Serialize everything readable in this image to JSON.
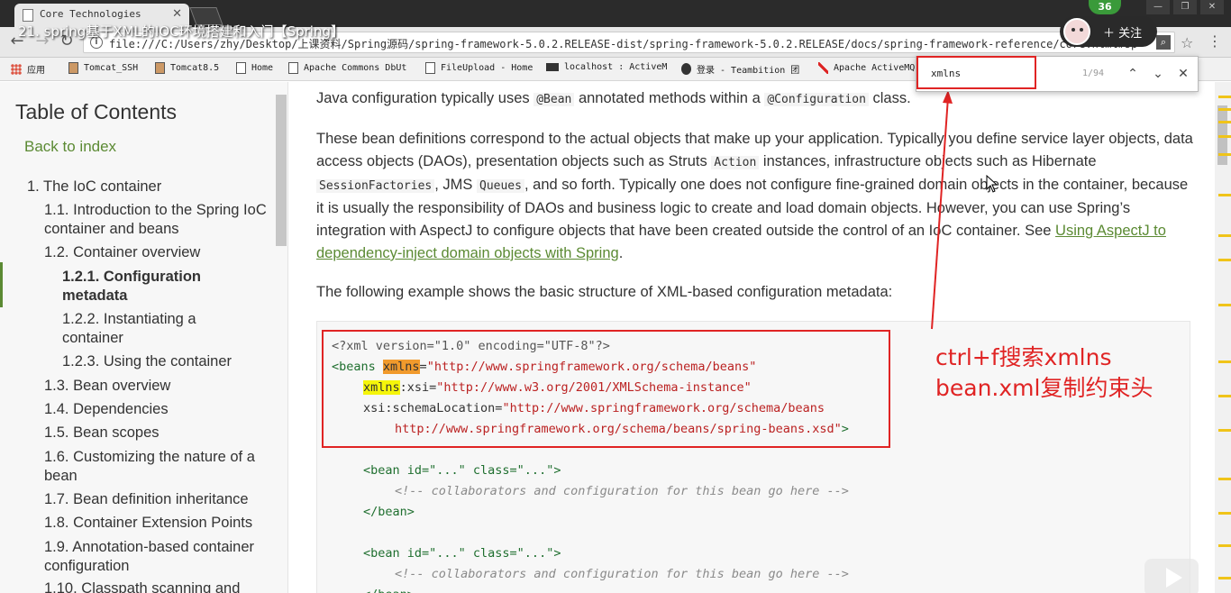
{
  "video_overlay": {
    "title": "21. spring基于XML的IOC环境搭建和入门【Spring】",
    "follow_label": "关注",
    "badge_count": "36"
  },
  "browser": {
    "tab_title": "Core Technologies",
    "url": "file:///C:/Users/zhy/Desktop/上课资料/Spring源码/spring-framework-5.0.2.RELEASE-dist/spring-framework-5.0.2.RELEASE/docs/spring-framework-reference/core.html#spring",
    "bookmarks": [
      "应用",
      "Tomcat_SSH",
      "Tomcat8.5",
      "Home",
      "Apache Commons DbUt",
      "FileUpload - Home",
      "localhost : ActiveM",
      "登录 - Teambition 团",
      "Apache ActiveMQ"
    ]
  },
  "find": {
    "query": "xmlns",
    "count": "1/94"
  },
  "sidebar": {
    "title": "Table of Contents",
    "back": "Back to index",
    "items": [
      {
        "label": "1. The IoC container"
      },
      {
        "label": "1.1. Introduction to the Spring IoC container and beans"
      },
      {
        "label": "1.2. Container overview"
      },
      {
        "label": "1.2.1. Configuration metadata"
      },
      {
        "label": "1.2.2. Instantiating a container"
      },
      {
        "label": "1.2.3. Using the container"
      },
      {
        "label": "1.3. Bean overview"
      },
      {
        "label": "1.4. Dependencies"
      },
      {
        "label": "1.5. Bean scopes"
      },
      {
        "label": "1.6. Customizing the nature of a bean"
      },
      {
        "label": "1.7. Bean definition inheritance"
      },
      {
        "label": "1.8. Container Extension Points"
      },
      {
        "label": "1.9. Annotation-based container configuration"
      },
      {
        "label": "1.10. Classpath scanning and"
      }
    ]
  },
  "content": {
    "p0_text1": "Java configuration typically uses ",
    "p0_code1": "@Bean",
    "p0_text2": " annotated methods within a ",
    "p0_code2": "@Configuration",
    "p0_text3": " class.",
    "p1_text1": "These bean definitions correspond to the actual objects that make up your application. Typically you define service layer objects, data access objects (DAOs), presentation objects such as Struts ",
    "p1_code1": "Action",
    "p1_text2": " instances, infrastructure objects such as Hibernate ",
    "p1_code2": "SessionFactories",
    "p1_text3": ", JMS ",
    "p1_code3": "Queues",
    "p1_text4": ", and so forth. Typically one does not configure fine-grained domain objects in the container, because it is usually the responsibility of DAOs and business logic to create and load domain objects. However, you can use Spring’s integration with AspectJ to configure objects that have been created outside the control of an IoC container. See ",
    "p1_link": "Using AspectJ to dependency-inject domain objects with Spring",
    "p1_text5": ".",
    "p2": "The following example shows the basic structure of XML-based configuration metadata:"
  },
  "code": {
    "l1": "<?xml version=\"1.0\" encoding=\"UTF-8\"?>",
    "beans_open": "<beans ",
    "xmlns": "xmlns",
    "ns_beans": "\"http://www.springframework.org/schema/beans\"",
    "xsi_suffix": ":xsi=",
    "ns_xsi": "\"http://www.w3.org/2001/XMLSchema-instance\"",
    "schema_loc": "xsi:schemaLocation=",
    "ns_loc1": "\"http://www.springframework.org/schema/beans",
    "ns_loc2": "http://www.springframework.org/schema/beans/spring-beans.xsd\"",
    "gt": ">",
    "bean_open": "<bean id=\"...\" class=\"...\">",
    "comment": "<!-- collaborators and configuration for this bean go here -->",
    "bean_close": "</bean>"
  },
  "annotation": {
    "line1": "ctrl+f搜索xmlns",
    "line2": "bean.xml复制约束头"
  }
}
